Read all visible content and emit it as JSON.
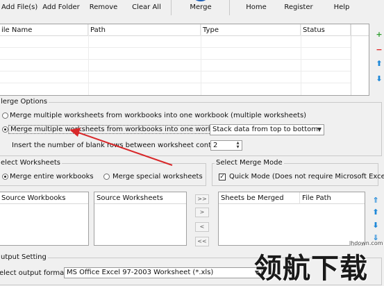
{
  "toolbar": {
    "add_files": "Add File(s)",
    "add_folder": "Add Folder",
    "remove": "Remove",
    "clear_all": "Clear All",
    "merge": "Merge",
    "home": "Home",
    "register": "Register",
    "help": "Help"
  },
  "file_table": {
    "columns": [
      "ile Name",
      "Path",
      "Type",
      "Status"
    ]
  },
  "merge_options": {
    "title": "lerge Options",
    "option1": "Merge multiple worksheets from workbooks into one workbook (multiple worksheets)",
    "option2": "Merge multiple worksheets from workbooks into one worksheet",
    "stack_select": "Stack data from top to bottom",
    "blank_rows_label": "Insert the number of blank rows between worksheet contents",
    "blank_rows_value": "2"
  },
  "select_worksheets": {
    "title": "elect Worksheets",
    "merge_entire": "Merge entire workbooks",
    "merge_special": "Merge special worksheets"
  },
  "merge_mode": {
    "title": "Select Merge Mode",
    "quick_mode": "Quick Mode (Does not require Microsoft Excel)"
  },
  "lists": {
    "source_workbooks": "Source Workbooks",
    "source_worksheets": "Source Worksheets",
    "sheets_merged": "Sheets be Merged",
    "file_path": "File Path",
    "move_all_right": ">>",
    "move_right": ">",
    "move_left": "<",
    "move_all_left": "<<"
  },
  "output": {
    "title": "utput Setting",
    "format_label": "elect output format:",
    "format_value": "MS Office Excel 97-2003 Worksheet (*.xls)"
  },
  "watermark": {
    "text": "领航下载",
    "url": "lhdown.com"
  },
  "colors": {
    "arrow": "#d8282a",
    "merge_icon": "#1f5fb4",
    "add_green": "#2e9e2e",
    "remove_red": "#e02020",
    "nav_blue": "#1e88d8"
  }
}
